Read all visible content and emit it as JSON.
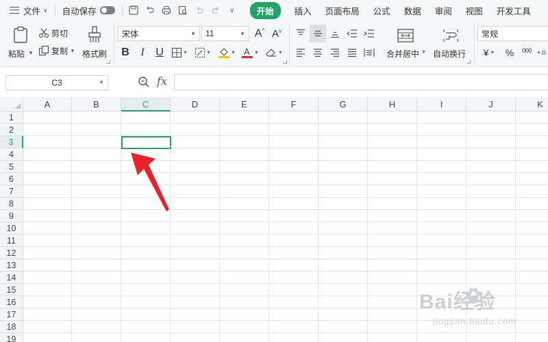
{
  "menu": {
    "file_label": "文件",
    "autosave_label": "自动保存",
    "tabs": [
      "开始",
      "插入",
      "页面布局",
      "公式",
      "数据",
      "审阅",
      "视图",
      "开发工具"
    ]
  },
  "ribbon": {
    "paste": "粘贴",
    "cut": "剪切",
    "copy": "复制",
    "format_painter": "格式刷",
    "font_name": "宋体",
    "font_size": "11",
    "bold": "B",
    "italic": "I",
    "underline": "U",
    "merge_center": "合并居中",
    "wrap_text": "自动换行",
    "number_format": "常规",
    "currency": "¥",
    "percent": "%",
    "thousands": "000",
    "decimal_add": "+.0"
  },
  "formula_bar": {
    "name_box": "C3",
    "fx": "fx",
    "formula": ""
  },
  "grid": {
    "columns": [
      "A",
      "B",
      "C",
      "D",
      "E",
      "F",
      "G",
      "H",
      "I",
      "J",
      "K"
    ],
    "rows": [
      "1",
      "2",
      "3",
      "4",
      "5",
      "6",
      "7",
      "8",
      "9",
      "10",
      "11",
      "12",
      "13",
      "14",
      "15",
      "16",
      "17",
      "18",
      "19"
    ],
    "selected_column": "C",
    "selected_row": "3"
  },
  "watermark": {
    "brand": "Bai经验",
    "url": "jingyan.baidu.com"
  },
  "colors": {
    "accent": "#21a366",
    "arrow": "#e8212a"
  }
}
